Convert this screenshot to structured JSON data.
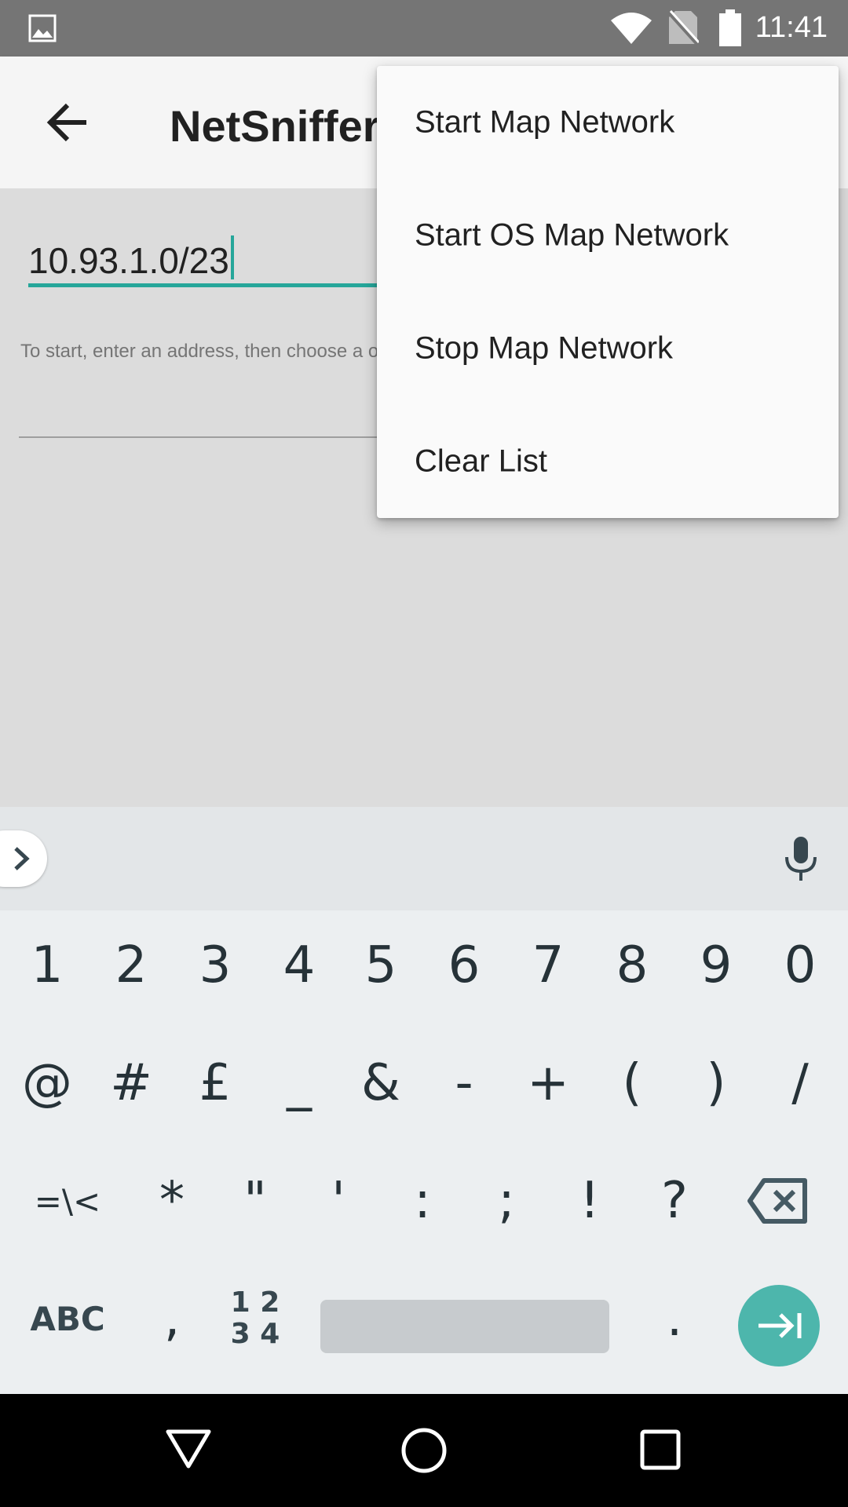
{
  "status_bar": {
    "time": "11:41",
    "icons": [
      "image-notification-icon",
      "wifi-icon",
      "no-sim-icon",
      "battery-icon"
    ]
  },
  "app_bar": {
    "title": "NetSniffer",
    "back_icon": "back-arrow-icon"
  },
  "content": {
    "ip_value": "10.93.1.0/23",
    "hint": "To start, enter an address, then choose a option from the menu."
  },
  "menu": {
    "items": [
      "Start Map Network",
      "Start OS Map Network",
      "Stop Map Network",
      "Clear List"
    ]
  },
  "keyboard": {
    "row1": [
      "1",
      "2",
      "3",
      "4",
      "5",
      "6",
      "7",
      "8",
      "9",
      "0"
    ],
    "row2": [
      "@",
      "#",
      "£",
      "_",
      "&",
      "-",
      "+",
      "(",
      ")",
      "/"
    ],
    "row3": [
      "=\\<",
      "*",
      "\"",
      "'",
      ":",
      ";",
      "!",
      "?"
    ],
    "abc_label": "ABC",
    "comma": ",",
    "numpad_top": "1 2",
    "numpad_bottom": "3 4",
    "period": "."
  },
  "colors": {
    "accent": "#26a69a",
    "enter_key": "#4db6ac",
    "status_bar": "#757575"
  }
}
